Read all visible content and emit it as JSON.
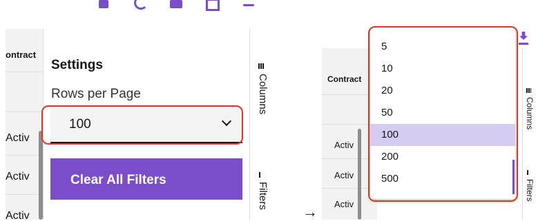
{
  "left": {
    "column_header": "ontract",
    "rows": [
      "Activ",
      "Activ",
      "Activ"
    ],
    "settings_title": "Settings",
    "rows_per_page_label": "Rows per Page",
    "selected_value": "100",
    "clear_filters_label": "Clear All Filters",
    "side_tabs": {
      "columns": "Columns",
      "filters": "Filters"
    }
  },
  "arrow": "→",
  "right": {
    "column_header": "Contract",
    "rows": [
      "Activ",
      "Activ",
      "Activ"
    ],
    "options": [
      "5",
      "10",
      "20",
      "50",
      "100",
      "200",
      "500"
    ],
    "selected_option": "100",
    "side_tabs": {
      "columns": "Columns",
      "filters": "Filters"
    }
  },
  "colors": {
    "accent": "#7c4dca",
    "highlight": "#d6cbf0",
    "annotation": "#e8341c"
  }
}
